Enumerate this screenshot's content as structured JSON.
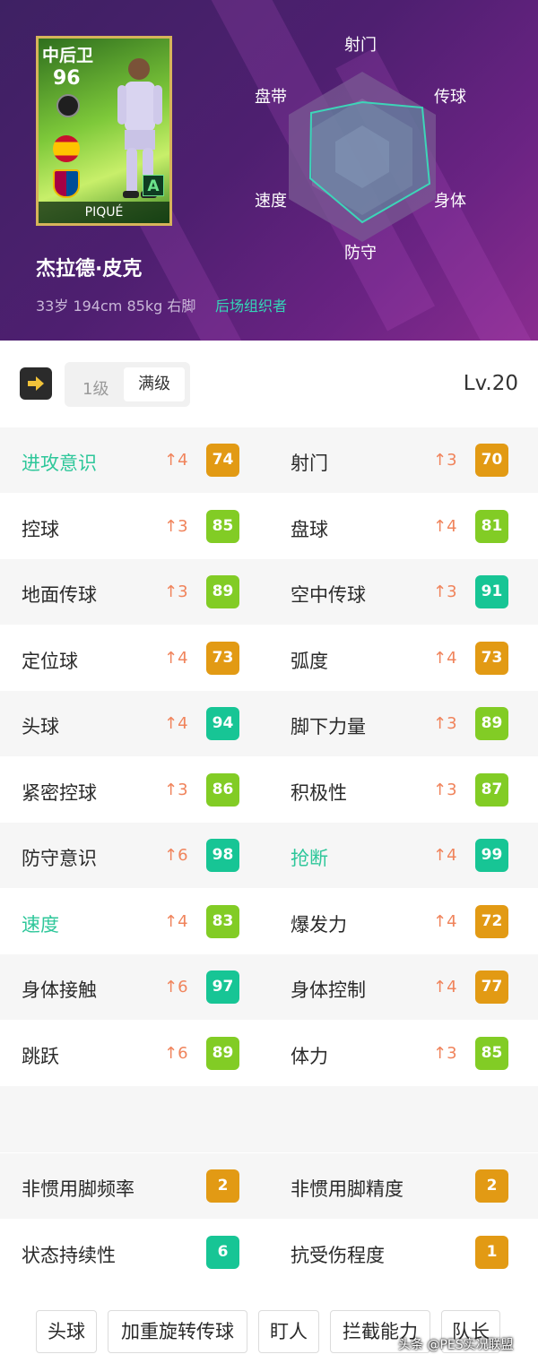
{
  "card": {
    "position": "中后卫",
    "overall": "96",
    "grade": "A",
    "name": "PIQUÉ"
  },
  "player": {
    "full_name": "杰拉德·皮克",
    "info": "33岁 194cm 85kg 右脚",
    "playstyle": "后场组织者"
  },
  "radar": {
    "labels": {
      "shoot": "射门",
      "pass": "传球",
      "physical": "身体",
      "defence": "防守",
      "speed": "速度",
      "dribble": "盘带"
    }
  },
  "level_bar": {
    "seg_1": "1级",
    "seg_max": "满级",
    "level": "Lv.20"
  },
  "colors": {
    "orange": "#e29a14",
    "lime": "#82cc25",
    "teal": "#17c595",
    "highlight": "#2ec79a",
    "arrow": "#f0845c"
  },
  "stats": [
    {
      "left": {
        "label": "进攻意识",
        "up": "↑4",
        "value": "74"
      },
      "right": {
        "label": "射门",
        "up": "↑3",
        "value": "70"
      }
    },
    {
      "left": {
        "label": "控球",
        "up": "↑3",
        "value": "85"
      },
      "right": {
        "label": "盘球",
        "up": "↑4",
        "value": "81"
      }
    },
    {
      "left": {
        "label": "地面传球",
        "up": "↑3",
        "value": "89"
      },
      "right": {
        "label": "空中传球",
        "up": "↑3",
        "value": "91"
      }
    },
    {
      "left": {
        "label": "定位球",
        "up": "↑4",
        "value": "73"
      },
      "right": {
        "label": "弧度",
        "up": "↑4",
        "value": "73"
      }
    },
    {
      "left": {
        "label": "头球",
        "up": "↑4",
        "value": "94"
      },
      "right": {
        "label": "脚下力量",
        "up": "↑3",
        "value": "89"
      }
    },
    {
      "left": {
        "label": "紧密控球",
        "up": "↑3",
        "value": "86"
      },
      "right": {
        "label": "积极性",
        "up": "↑3",
        "value": "87"
      }
    },
    {
      "left": {
        "label": "防守意识",
        "up": "↑6",
        "value": "98"
      },
      "right": {
        "label": "抢断",
        "up": "↑4",
        "value": "99"
      }
    },
    {
      "left": {
        "label": "速度",
        "up": "↑4",
        "value": "83"
      },
      "right": {
        "label": "爆发力",
        "up": "↑4",
        "value": "72"
      }
    },
    {
      "left": {
        "label": "身体接触",
        "up": "↑6",
        "value": "97"
      },
      "right": {
        "label": "身体控制",
        "up": "↑4",
        "value": "77"
      }
    },
    {
      "left": {
        "label": "跳跃",
        "up": "↑6",
        "value": "89"
      },
      "right": {
        "label": "体力",
        "up": "↑3",
        "value": "85"
      }
    }
  ],
  "extra": [
    {
      "left": {
        "label": "非惯用脚频率",
        "value": "2"
      },
      "right": {
        "label": "非惯用脚精度",
        "value": "2"
      }
    },
    {
      "left": {
        "label": "状态持续性",
        "value": "6"
      },
      "right": {
        "label": "抗受伤程度",
        "value": "1"
      }
    }
  ],
  "skills": [
    "头球",
    "加重旋转传球",
    "盯人",
    "拦截能力",
    "队长"
  ],
  "watermark": "头条 @PES实况联盟"
}
